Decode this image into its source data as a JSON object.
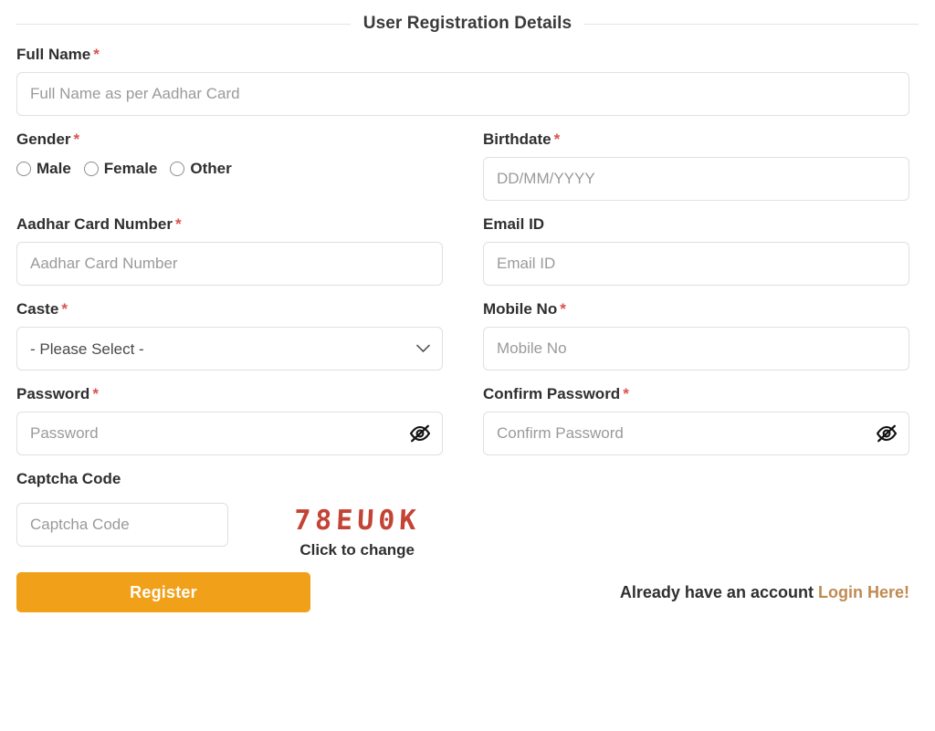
{
  "header": {
    "title": "User Registration Details"
  },
  "colors": {
    "required_asterisk": "#d9534f",
    "register_button": "#f0a019",
    "login_link": "#c08a52",
    "captcha_text": "#c0392b",
    "input_border": "#e0e0e0",
    "placeholder": "#9a9a9a"
  },
  "fields": {
    "full_name": {
      "label": "Full Name",
      "required_mark": "*",
      "placeholder": "Full Name as per Aadhar Card",
      "value": ""
    },
    "gender": {
      "label": "Gender",
      "required_mark": "*",
      "options": [
        {
          "label": "Male",
          "selected": false
        },
        {
          "label": "Female",
          "selected": false
        },
        {
          "label": "Other",
          "selected": false
        }
      ]
    },
    "birthdate": {
      "label": "Birthdate",
      "required_mark": "*",
      "placeholder": "DD/MM/YYYY",
      "value": ""
    },
    "aadhar_card_number": {
      "label": "Aadhar Card Number",
      "required_mark": "*",
      "placeholder": "Aadhar Card Number",
      "value": ""
    },
    "email_id": {
      "label": "Email ID",
      "required_mark": "",
      "placeholder": "Email ID",
      "value": ""
    },
    "caste": {
      "label": "Caste",
      "required_mark": "*",
      "selected_option": "- Please Select -",
      "chevron_icon": "chevron-down-icon"
    },
    "mobile_no": {
      "label": "Mobile No",
      "required_mark": "*",
      "placeholder": "Mobile No",
      "value": ""
    },
    "password": {
      "label": "Password",
      "required_mark": "*",
      "placeholder": "Password",
      "value": "",
      "toggle_icon": "eye-slash-icon"
    },
    "confirm_password": {
      "label": "Confirm Password",
      "required_mark": "*",
      "placeholder": "Confirm Password",
      "value": "",
      "toggle_icon": "eye-slash-icon"
    },
    "captcha": {
      "label": "Captcha Code",
      "required_mark": "",
      "placeholder": "Captcha Code",
      "value": "",
      "code": "78EU0K",
      "refresh_hint": "Click to change"
    }
  },
  "footer": {
    "register_label": "Register",
    "login_prompt": "Already have an account",
    "login_link_label": "Login Here!"
  }
}
